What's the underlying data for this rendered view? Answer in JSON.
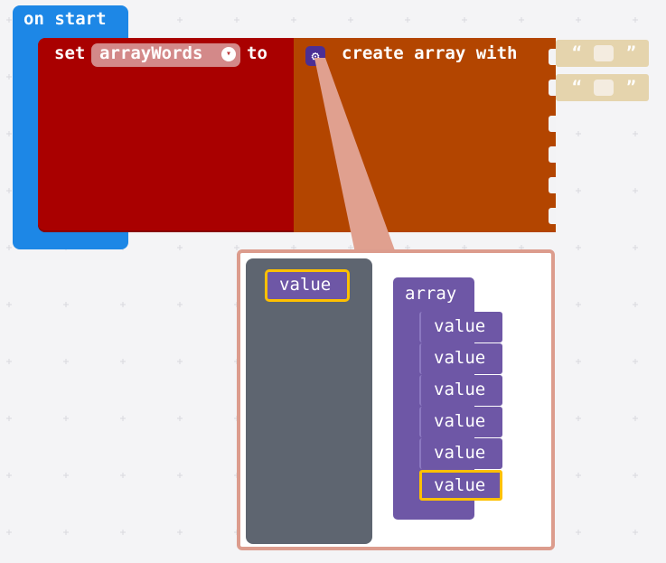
{
  "workspace": {
    "on_start_label": "on start",
    "set_label": "set",
    "variable_name": "arrayWords",
    "dropdown_arrow": "▾",
    "to_label": "to",
    "create_array_label": "create array with",
    "string_quote_open": "“",
    "string_quote_close": "”",
    "gear_icon": "⚙"
  },
  "mutator": {
    "flyout_value_label": "value",
    "array_label": "array",
    "value_items": [
      "value",
      "value",
      "value",
      "value",
      "value",
      "value"
    ],
    "selected_index": 5
  },
  "colors": {
    "event_block": "#1d87e6",
    "set_block": "#a90000",
    "array_block": "#b34500",
    "string_block": "#e5d4ad",
    "array_mutator_block": "#6e57a6",
    "selection_outline": "#fec000",
    "flyout_bg": "#5e6570",
    "bubble_border": "#dc9c8d"
  }
}
